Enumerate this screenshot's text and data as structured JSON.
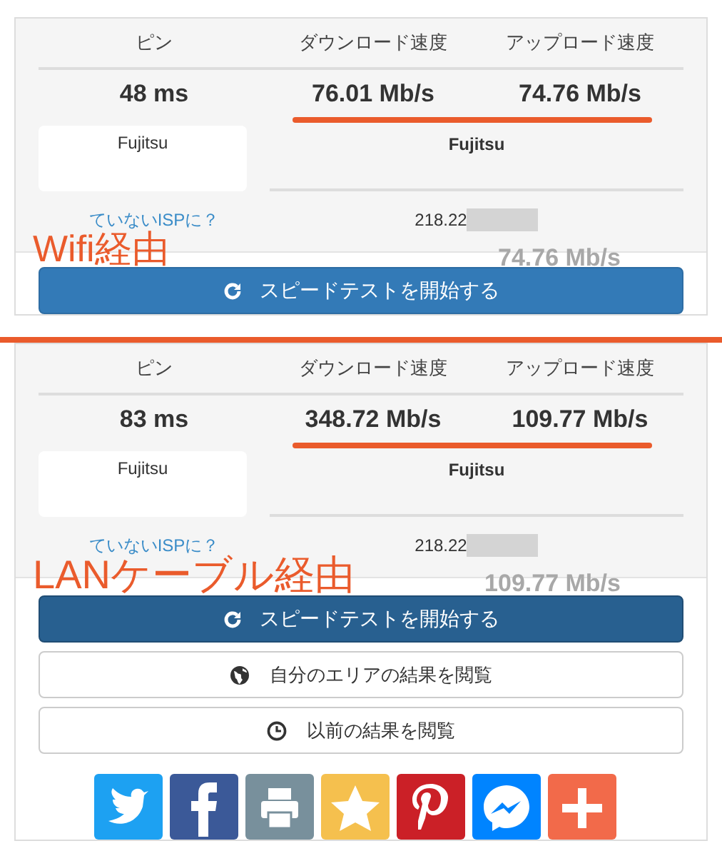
{
  "panels": [
    {
      "annotation": "Wifi経由",
      "headers": [
        "ピン",
        "ダウンロード速度",
        "アップロード速度"
      ],
      "ping": "48 ms",
      "download": "76.01 Mb/s",
      "upload": "74.76 Mb/s",
      "isp_box": "Fujitsu",
      "isp": "Fujitsu",
      "isp_link": "ていないISPに？",
      "ip": "218.22",
      "faded_reading": "74.76 Mb/s",
      "start_button": {
        "label": "スピードテストを開始する",
        "hovered": false
      }
    },
    {
      "annotation": "LANケーブル経由",
      "headers": [
        "ピン",
        "ダウンロード速度",
        "アップロード速度"
      ],
      "ping": "83 ms",
      "download": "348.72 Mb/s",
      "upload": "109.77 Mb/s",
      "isp_box": "Fujitsu",
      "isp": "Fujitsu",
      "isp_link": "ていないISPに？",
      "ip": "218.22",
      "faded_reading": "109.77 Mb/s",
      "start_button": {
        "label": "スピードテストを開始する",
        "hovered": true
      },
      "buttons": [
        {
          "kind": "globe",
          "label": "自分のエリアの結果を閲覧"
        },
        {
          "kind": "clock",
          "label": "以前の結果を閲覧"
        }
      ],
      "share": [
        {
          "kind": "twitter"
        },
        {
          "kind": "facebook"
        },
        {
          "kind": "print"
        },
        {
          "kind": "star"
        },
        {
          "kind": "pinterest"
        },
        {
          "kind": "messenger"
        },
        {
          "kind": "plus"
        }
      ]
    }
  ]
}
